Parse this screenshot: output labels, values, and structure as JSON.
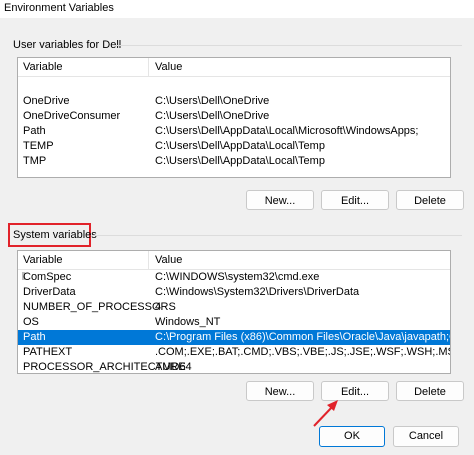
{
  "window": {
    "title": "Environment Variables"
  },
  "user_section": {
    "label": "User variables for Dell",
    "columns": [
      "Variable",
      "Value"
    ],
    "rows": [
      {
        "variable": "OneDrive",
        "value": "C:\\Users\\Dell\\OneDrive"
      },
      {
        "variable": "OneDriveConsumer",
        "value": "C:\\Users\\Dell\\OneDrive"
      },
      {
        "variable": "Path",
        "value": "C:\\Users\\Dell\\AppData\\Local\\Microsoft\\WindowsApps;"
      },
      {
        "variable": "TEMP",
        "value": "C:\\Users\\Dell\\AppData\\Local\\Temp"
      },
      {
        "variable": "TMP",
        "value": "C:\\Users\\Dell\\AppData\\Local\\Temp"
      }
    ],
    "buttons": {
      "new": "New...",
      "edit": "Edit...",
      "delete": "Delete"
    }
  },
  "system_section": {
    "label": "System variables",
    "columns": [
      "Variable",
      "Value"
    ],
    "rows": [
      {
        "variable": "ComSpec",
        "value": "C:\\WINDOWS\\system32\\cmd.exe"
      },
      {
        "variable": "DriverData",
        "value": "C:\\Windows\\System32\\Drivers\\DriverData"
      },
      {
        "variable": "NUMBER_OF_PROCESSORS",
        "value": "4"
      },
      {
        "variable": "OS",
        "value": "Windows_NT"
      },
      {
        "variable": "Path",
        "value": "C:\\Program Files (x86)\\Common Files\\Oracle\\Java\\javapath;C:\\WIN..."
      },
      {
        "variable": "PATHEXT",
        "value": ".COM;.EXE;.BAT;.CMD;.VBS;.VBE;.JS;.JSE;.WSF;.WSH;.MSC"
      },
      {
        "variable": "PROCESSOR_ARCHITECTURE",
        "value": "AMD64"
      }
    ],
    "selected_variable": "Path",
    "buttons": {
      "new": "New...",
      "edit": "Edit...",
      "delete": "Delete"
    }
  },
  "footer": {
    "ok": "OK",
    "cancel": "Cancel"
  },
  "colors": {
    "selection": "#0078d7",
    "annotation": "#e1222a"
  }
}
